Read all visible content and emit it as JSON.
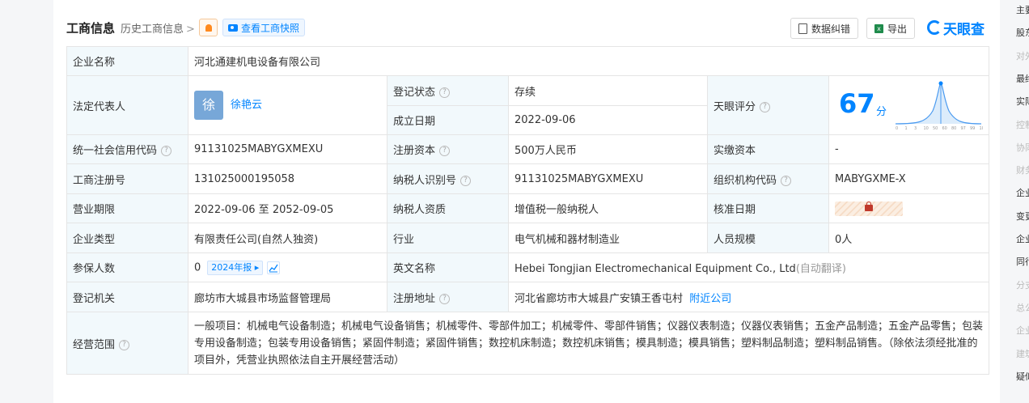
{
  "header": {
    "title": "工商信息",
    "history_link": "历史工商信息",
    "snapshot_button": "查看工商快照",
    "correction_button": "数据纠错",
    "export_button": "导出",
    "brand": "天眼查"
  },
  "company": {
    "name_label": "企业名称",
    "name": "河北通建机电设备有限公司",
    "legal_rep_label": "法定代表人",
    "legal_rep_avatar": "徐",
    "legal_rep": "徐艳云",
    "reg_status_label": "登记状态",
    "reg_status": "存续",
    "found_date_label": "成立日期",
    "found_date": "2022-09-06",
    "score_label": "天眼评分",
    "score": "67",
    "score_unit": "分",
    "score_axis": [
      "0",
      "1",
      "3",
      "10",
      "50",
      "60",
      "80",
      "97",
      "99",
      "100"
    ],
    "credit_code_label": "统一社会信用代码",
    "credit_code": "91131025MABYGXMEXU",
    "reg_capital_label": "注册资本",
    "reg_capital": "500万人民币",
    "paid_capital_label": "实缴资本",
    "paid_capital": "-",
    "reg_no_label": "工商注册号",
    "reg_no": "131025000195058",
    "taxpayer_id_label": "纳税人识别号",
    "taxpayer_id": "91131025MABYGXMEXU",
    "org_code_label": "组织机构代码",
    "org_code": "MABYGXME-X",
    "term_label": "营业期限",
    "term": "2022-09-06 至 2052-09-05",
    "taxpayer_type_label": "纳税人资质",
    "taxpayer_type": "增值税一般纳税人",
    "approve_date_label": "核准日期",
    "type_label": "企业类型",
    "type": "有限责任公司(自然人独资)",
    "industry_label": "行业",
    "industry": "电气机械和器材制造业",
    "staff_size_label": "人员规模",
    "staff_size": "0人",
    "insured_label": "参保人数",
    "insured": "0",
    "insured_report": "2024年报",
    "english_name_label": "英文名称",
    "english_name": "Hebei Tongjian Electromechanical Equipment Co., Ltd",
    "english_note": "(自动翻译)",
    "authority_label": "登记机关",
    "authority": "廊坊市大城县市场监督管理局",
    "address_label": "注册地址",
    "address": "河北省廊坊市大城县广安镇王香屯村",
    "nearby_link": "附近公司",
    "scope_label": "经营范围",
    "scope": "一般项目：机械电气设备制造；机械电气设备销售；机械零件、零部件加工；机械零件、零部件销售；仪器仪表制造；仪器仪表销售；五金产品制造；五金产品零售；包装专用设备制造；包装专用设备销售；紧固件制造；紧固件销售；数控机床制造；数控机床销售；模具制造；模具销售；塑料制品制造；塑料制品销售。（除依法须经批准的项目外，凭营业执照依法自主开展经营活动）"
  },
  "right_nav": [
    {
      "label": "主要",
      "dim": false
    },
    {
      "label": "股东",
      "dim": false
    },
    {
      "label": "对外",
      "dim": true
    },
    {
      "label": "最终",
      "dim": false
    },
    {
      "label": "实际",
      "dim": false
    },
    {
      "label": "控制",
      "dim": true
    },
    {
      "label": "协同",
      "dim": true
    },
    {
      "label": "财务",
      "dim": true
    },
    {
      "label": "企业",
      "dim": false
    },
    {
      "label": "变更",
      "dim": false
    },
    {
      "label": "企业",
      "dim": false
    },
    {
      "label": "同行",
      "dim": false
    },
    {
      "label": "分支",
      "dim": true
    },
    {
      "label": "总公",
      "dim": true
    },
    {
      "label": "企业",
      "dim": true
    },
    {
      "label": "建筑",
      "dim": true
    },
    {
      "label": "疑似",
      "dim": false
    }
  ],
  "colors": {
    "accent": "#0084ff",
    "status_green": "#3db06d",
    "label_bg": "#f2f9fc"
  }
}
